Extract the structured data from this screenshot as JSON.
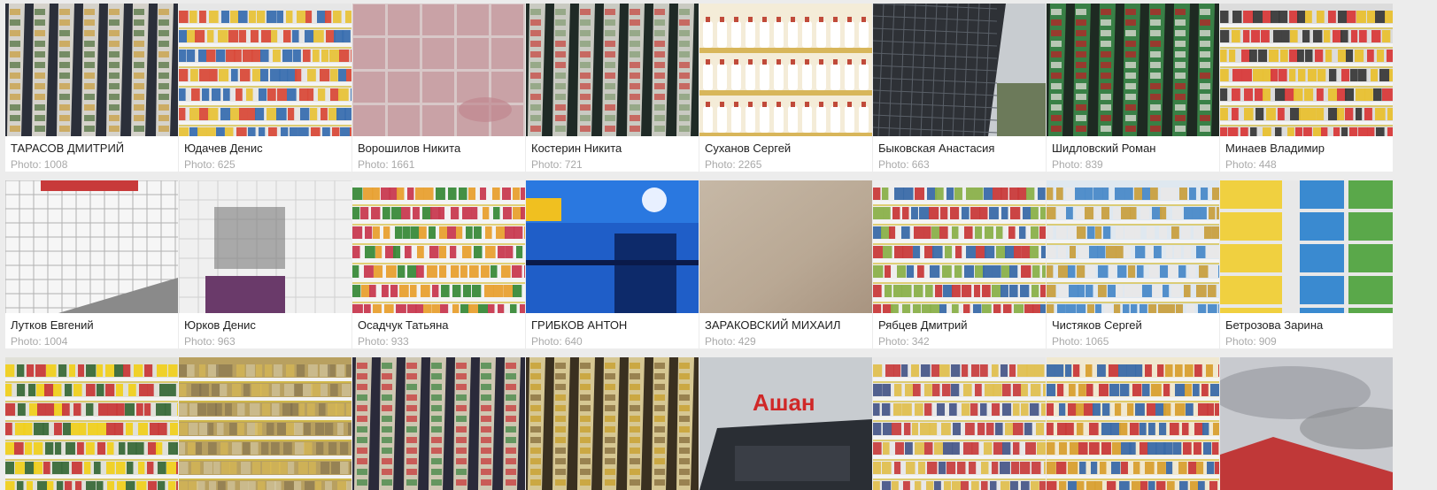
{
  "photo_label": "Photo:",
  "rows": [
    [
      {
        "name": "ТАРАСОВ ДМИТРИЙ",
        "count": "1008",
        "scene": "fridge-aisle",
        "palette": [
          "#2b2f3a",
          "#e8e4dc",
          "#c9a24a",
          "#5d7a4a"
        ]
      },
      {
        "name": "Юдачев Денис",
        "count": "625",
        "scene": "shelves",
        "palette": [
          "#e6e6e6",
          "#d94b3a",
          "#e8c33a",
          "#3a6fb0"
        ]
      },
      {
        "name": "Ворошилов Никита",
        "count": "1661",
        "scene": "floor-tiles",
        "palette": [
          "#d8c8c8",
          "#e4d4d4",
          "#c08890",
          "#f0e6e6"
        ]
      },
      {
        "name": "Костерин Никита",
        "count": "721",
        "scene": "fridge-aisle",
        "palette": [
          "#1f2a26",
          "#dcdcd4",
          "#c7504a",
          "#8ba07a"
        ]
      },
      {
        "name": "Суханов Сергей",
        "count": "2265",
        "scene": "bottles",
        "palette": [
          "#f4ecd8",
          "#ffffff",
          "#d8b65a",
          "#c04a3a"
        ]
      },
      {
        "name": "Быковская Анастасия",
        "count": "663",
        "scene": "building",
        "palette": [
          "#5a6068",
          "#2e3136",
          "#c8ccd0",
          "#6c7a5a"
        ]
      },
      {
        "name": "Шидловский Роман",
        "count": "839",
        "scene": "fridge-aisle",
        "palette": [
          "#1e2a22",
          "#3c8a4a",
          "#d8d8d0",
          "#b02828"
        ]
      },
      {
        "name": "Минаев Владимир",
        "count": "448",
        "scene": "shelves",
        "palette": [
          "#dcdcdc",
          "#3a3a3a",
          "#d83a3a",
          "#e8c030"
        ]
      }
    ],
    [
      {
        "name": "Лутков Евгений",
        "count": "1004",
        "scene": "wall-tiles",
        "palette": [
          "#e8e8e8",
          "#f6f6f6",
          "#b0b0b0",
          "#c83a3a"
        ]
      },
      {
        "name": "Юрков Денис",
        "count": "963",
        "scene": "wall-window",
        "palette": [
          "#f0f0f0",
          "#7a7a7a",
          "#d0d0d0",
          "#6a3a6a"
        ]
      },
      {
        "name": "Осадчук Татьяна",
        "count": "933",
        "scene": "shelves",
        "palette": [
          "#f2f2f2",
          "#e8a030",
          "#3a8a3a",
          "#c83a50"
        ]
      },
      {
        "name": "ГРИБКОВ АНТОН",
        "count": "640",
        "scene": "storefront",
        "palette": [
          "#1f5ec8",
          "#f0c020",
          "#0d2a6a",
          "#2a2a2a"
        ]
      },
      {
        "name": "ЗАРАКОВСКИЙ МИХАИЛ",
        "count": "429",
        "scene": "blur",
        "palette": [
          "#b9a894",
          "#c6b8a6",
          "#a89480",
          "#d2c6b6"
        ]
      },
      {
        "name": "Рябцев Дмитрий",
        "count": "342",
        "scene": "shelves",
        "palette": [
          "#eeeeee",
          "#c83a3a",
          "#3a6aa8",
          "#8ab04a"
        ]
      },
      {
        "name": "Чистяков Сергей",
        "count": "1065",
        "scene": "shelves",
        "palette": [
          "#dfe8f0",
          "#4a8ac8",
          "#e8e8e8",
          "#c8a040"
        ]
      },
      {
        "name": "Бетрозова Зарина",
        "count": "909",
        "scene": "boxes",
        "palette": [
          "#f0d040",
          "#3a8ad0",
          "#e8e8e8",
          "#c84040"
        ]
      }
    ],
    [
      {
        "name": "",
        "count": "",
        "scene": "shelves",
        "palette": [
          "#e0e0d8",
          "#c83a3a",
          "#f0d020",
          "#3a6a3a"
        ]
      },
      {
        "name": "",
        "count": "",
        "scene": "blur-shelves",
        "palette": [
          "#b8a060",
          "#e0c050",
          "#7a6a4a",
          "#d8d0b0"
        ]
      },
      {
        "name": "",
        "count": "",
        "scene": "fridge-aisle",
        "palette": [
          "#2a2a3a",
          "#e0d8c0",
          "#c84040",
          "#4a8a4a"
        ]
      },
      {
        "name": "",
        "count": "",
        "scene": "fridge-aisle",
        "palette": [
          "#3a3020",
          "#e8d8a0",
          "#c8a030",
          "#8a7040"
        ]
      },
      {
        "name": "",
        "count": "",
        "scene": "auchan",
        "palette": [
          "#c8ccd0",
          "#d02828",
          "#2a2e34",
          "#e8e8e8"
        ]
      },
      {
        "name": "",
        "count": "",
        "scene": "shelves",
        "palette": [
          "#e8e8e8",
          "#4a5a8a",
          "#c84040",
          "#e0c050"
        ]
      },
      {
        "name": "",
        "count": "",
        "scene": "shelves",
        "palette": [
          "#f0e8d0",
          "#d8a030",
          "#3a6aa8",
          "#c83a3a"
        ]
      },
      {
        "name": "",
        "count": "",
        "scene": "sky",
        "palette": [
          "#a8aab0",
          "#c8cacf",
          "#c03838",
          "#8a8c90"
        ]
      }
    ]
  ],
  "sign_text": "Ашан"
}
